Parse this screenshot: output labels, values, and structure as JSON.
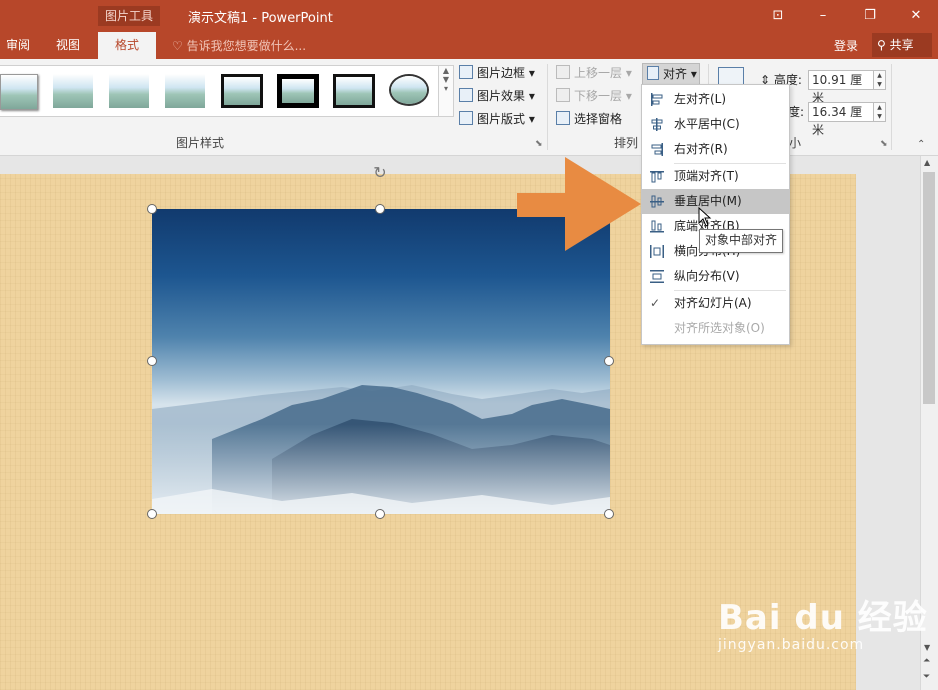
{
  "window": {
    "context_tab_group": "图片工具",
    "title": "演示文稿1 - PowerPoint",
    "controls": [
      "ribbon-display-icon",
      "minimize-icon",
      "restore-icon",
      "close-icon"
    ]
  },
  "tabs": [
    {
      "label": "审阅",
      "active": false
    },
    {
      "label": "视图",
      "active": false
    },
    {
      "label": "格式",
      "active": true
    }
  ],
  "tell_me": {
    "placeholder": "告诉我您想要做什么..."
  },
  "account": {
    "login": "登录",
    "share": "共享"
  },
  "ribbon": {
    "picture_styles": {
      "group_label": "图片样式",
      "commands": [
        "图片边框",
        "图片效果",
        "图片版式"
      ]
    },
    "arrange": {
      "group_label": "排列",
      "bring_forward": "上移一层",
      "send_backward": "下移一层",
      "selection_pane": "选择窗格",
      "align": "对齐"
    },
    "size": {
      "group_label_fragment": "小",
      "height_label": "高度:",
      "height_value": "10.91 厘米",
      "width_label_fragment": "度:",
      "width_value": "16.34 厘米"
    }
  },
  "align_menu": {
    "items": [
      {
        "label": "左对齐(L)",
        "icon": "align-left-icon",
        "state": "normal"
      },
      {
        "label": "水平居中(C)",
        "icon": "align-center-icon",
        "state": "normal"
      },
      {
        "label": "右对齐(R)",
        "icon": "align-right-icon",
        "state": "normal"
      },
      {
        "label": "顶端对齐(T)",
        "icon": "align-top-icon",
        "state": "normal"
      },
      {
        "label": "垂直居中(M)",
        "icon": "align-middle-icon",
        "state": "hover"
      },
      {
        "label": "底端对齐(B)",
        "icon": "align-bottom-icon",
        "state": "normal"
      },
      {
        "label": "横向分布(H)",
        "icon": "distribute-horizontal-icon",
        "state": "normal"
      },
      {
        "label": "纵向分布(V)",
        "icon": "distribute-vertical-icon",
        "state": "normal"
      },
      {
        "label": "对齐幻灯片(A)",
        "icon": "checkmark-icon",
        "state": "checked"
      },
      {
        "label": "对齐所选对象(O)",
        "icon": "",
        "state": "disabled"
      }
    ],
    "tooltip": "对象中部对齐"
  },
  "watermark": {
    "main": "Bai du 经验",
    "sub": "jingyan.baidu.com"
  },
  "colors": {
    "accent": "#b7472a",
    "arrow": "#e88b42",
    "menu_hover": "#c6c6c6"
  }
}
